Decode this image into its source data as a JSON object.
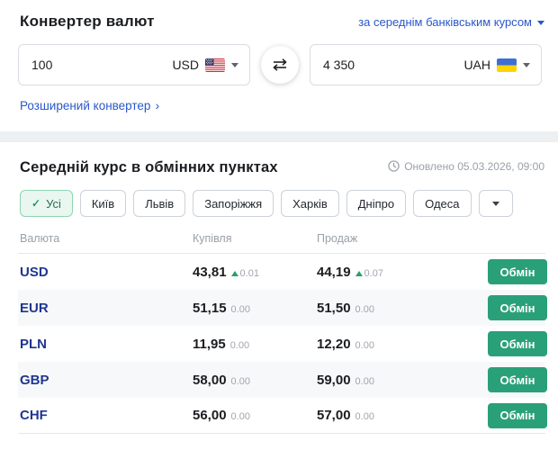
{
  "converter": {
    "title": "Конвертер валют",
    "rate_selector_label": "за середнім банківським курсом",
    "from": {
      "amount": "100",
      "currency": "USD"
    },
    "to": {
      "amount": "4 350",
      "currency": "UAH"
    },
    "advanced_link": "Розширений конвертер",
    "advanced_chevron": "›"
  },
  "rates": {
    "title": "Середній курс в обмінних пунктах",
    "updated": "Оновлено 05.03.2026, 09:00",
    "filters": [
      "Усі",
      "Київ",
      "Львів",
      "Запоріжжя",
      "Харків",
      "Дніпро",
      "Одеса"
    ],
    "active_filter": "Усі",
    "check_glyph": "✓",
    "table": {
      "headers": [
        "Валюта",
        "Купівля",
        "Продаж"
      ],
      "action_label": "Обмін",
      "rows": [
        {
          "code": "USD",
          "buy": "43,81",
          "buy_delta": "0.01",
          "buy_trend": "up",
          "sell": "44,19",
          "sell_delta": "0.07",
          "sell_trend": "up"
        },
        {
          "code": "EUR",
          "buy": "51,15",
          "buy_delta": "0.00",
          "buy_trend": "flat",
          "sell": "51,50",
          "sell_delta": "0.00",
          "sell_trend": "flat"
        },
        {
          "code": "PLN",
          "buy": "11,95",
          "buy_delta": "0.00",
          "buy_trend": "flat",
          "sell": "12,20",
          "sell_delta": "0.00",
          "sell_trend": "flat"
        },
        {
          "code": "GBP",
          "buy": "58,00",
          "buy_delta": "0.00",
          "buy_trend": "flat",
          "sell": "59,00",
          "sell_delta": "0.00",
          "sell_trend": "flat"
        },
        {
          "code": "CHF",
          "buy": "56,00",
          "buy_delta": "0.00",
          "buy_trend": "flat",
          "sell": "57,00",
          "sell_delta": "0.00",
          "sell_trend": "flat"
        }
      ]
    }
  },
  "colors": {
    "link_blue": "#2a57c9",
    "code_navy": "#20368f",
    "button_green": "#2aa079",
    "trend_green": "#27a06a",
    "muted_gray": "#9aa1a9",
    "divider": "#edf0f3",
    "alt_row": "#f7f8f9"
  }
}
